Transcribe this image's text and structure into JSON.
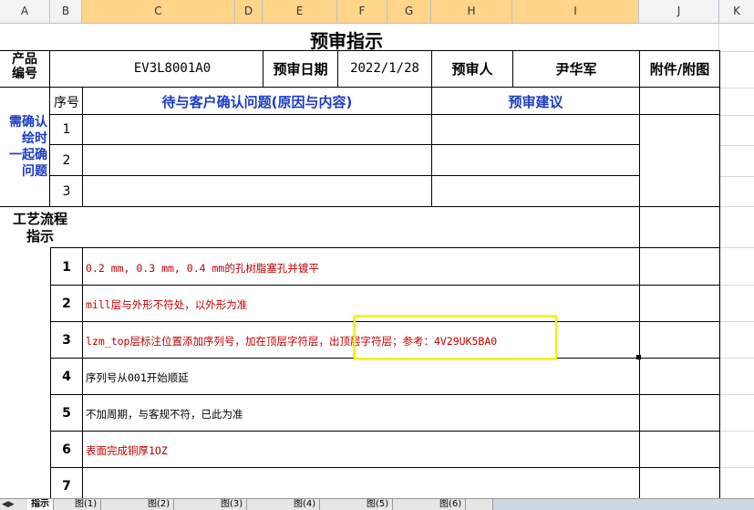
{
  "columns": [
    "A",
    "B",
    "C",
    "D",
    "E",
    "F",
    "G",
    "H",
    "I",
    "J",
    "K"
  ],
  "title": "预审指示",
  "product_label": "产品编号",
  "product_label_lines": [
    "产品",
    "编号"
  ],
  "product_code": "EV3L8001A0",
  "review_date_label": "预审日期",
  "review_date": "2022/1/28",
  "reviewer_label": "预审人",
  "reviewer_name": "尹华军",
  "attachment_label": "附件/附图",
  "seq_label": "序号",
  "question_header": "待与客户确认问题(原因与内容)",
  "advice_header": "预审建议",
  "side_label_lines": [
    "需确认",
    "绘时",
    "一起确",
    "问题"
  ],
  "confirm_rows": [
    "1",
    "2",
    "3"
  ],
  "process_label_lines": [
    "工艺流程",
    "指示"
  ],
  "process_rows": [
    {
      "num": "1",
      "text": "0.2 mm, 0.3 mm, 0.4 mm的孔树脂塞孔并镀平",
      "color": "#c00000"
    },
    {
      "num": "2",
      "text": "mill层与外形不符处，以外形为准",
      "color": "#c00000"
    },
    {
      "num": "3",
      "text": "lzm_top层标注位置添加序列号，加在顶层字符层，出顶层字符层；参考：4V29UK5BA0",
      "color": "#c00000"
    },
    {
      "num": "4",
      "text": "序列号从001开始顺延",
      "color": "#000000"
    },
    {
      "num": "5",
      "text": "不加周期，与客规不符，已此为准",
      "color": "#000000"
    },
    {
      "num": "6",
      "text": "表面完成铜厚1OZ",
      "color": "#c00000"
    },
    {
      "num": "7",
      "text": "",
      "color": "#000000"
    }
  ],
  "sheet_tabs": [
    "指示",
    "图(1)",
    "图(2)",
    "图(3)",
    "图(4)",
    "图(5)",
    "图(6)"
  ],
  "highlight_color": "#f2ee1e"
}
